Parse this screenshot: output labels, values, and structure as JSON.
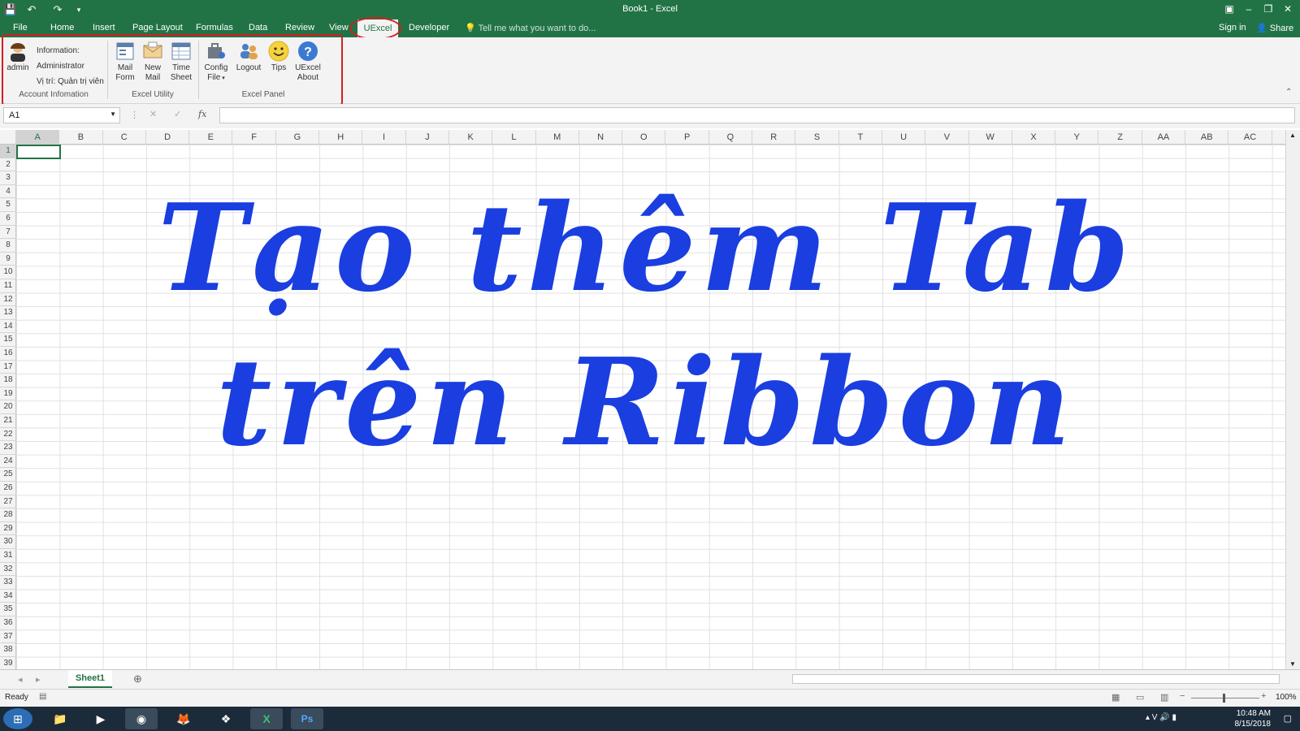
{
  "window": {
    "title": "Book1 - Excel",
    "sign_in": "Sign in",
    "share": "Share"
  },
  "tabs": [
    "File",
    "Home",
    "Insert",
    "Page Layout",
    "Formulas",
    "Data",
    "Review",
    "View",
    "UExcel",
    "Developer"
  ],
  "tell_me": "Tell me what you want to do...",
  "ribbon": {
    "account": {
      "user_label": "admin",
      "info_line1": "Information:",
      "info_line2": "Administrator",
      "info_line3": "Vị trí: Quản trị viên",
      "group_label": "Account Infomation"
    },
    "utility": {
      "mail_form": [
        "Mail",
        "Form"
      ],
      "new_mail": [
        "New",
        "Mail"
      ],
      "time_sheet": [
        "Time",
        "Sheet"
      ],
      "group_label": "Excel Utility"
    },
    "panel": {
      "config_file": [
        "Config",
        "File"
      ],
      "logout": "Logout",
      "tips": "Tips",
      "about": [
        "UExcel",
        "About"
      ],
      "group_label": "Excel Panel"
    }
  },
  "name_box": "A1",
  "fx_label": "fx",
  "columns": [
    "A",
    "B",
    "C",
    "D",
    "E",
    "F",
    "G",
    "H",
    "I",
    "J",
    "K",
    "L",
    "M",
    "N",
    "O",
    "P",
    "Q",
    "R",
    "S",
    "T",
    "U",
    "V",
    "W",
    "X",
    "Y",
    "Z",
    "AA",
    "AB",
    "AC"
  ],
  "rows": [
    "1",
    "2",
    "3",
    "4",
    "5",
    "6",
    "7",
    "8",
    "9",
    "10",
    "11",
    "12",
    "13",
    "14",
    "15",
    "16",
    "17",
    "18",
    "19",
    "20",
    "21",
    "22",
    "23",
    "24",
    "25",
    "26",
    "27",
    "28",
    "29",
    "30",
    "31",
    "32",
    "33",
    "34",
    "35",
    "36",
    "37",
    "38",
    "39"
  ],
  "overlay": {
    "line1": "Tạo thêm Tab",
    "line2": "trên Ribbon"
  },
  "sheet_tab": "Sheet1",
  "status": {
    "ready": "Ready",
    "zoom": "100%"
  },
  "clock": {
    "time": "10:48 AM",
    "date": "8/15/2018"
  },
  "colors": {
    "excel_green": "#217346",
    "highlight_red": "#d21f1f",
    "title_blue": "#1a3ee0"
  }
}
